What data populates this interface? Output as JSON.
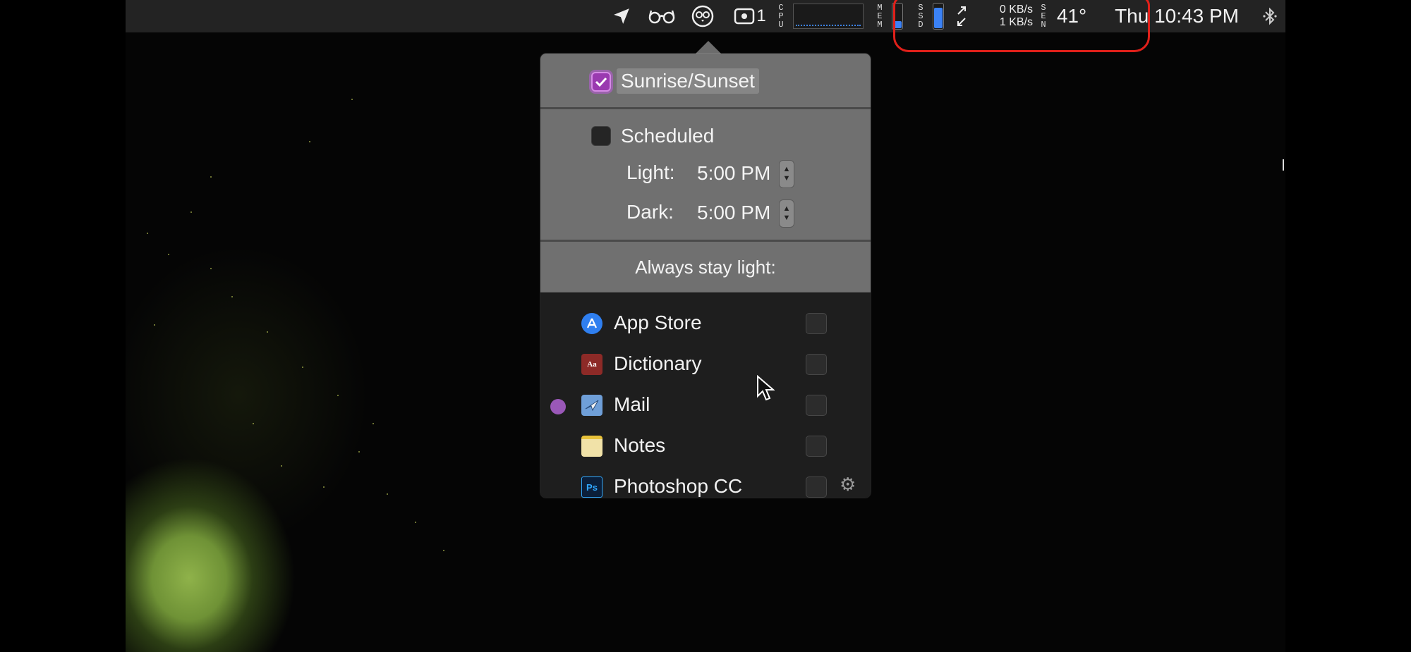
{
  "menubar": {
    "icons": [
      "location-arrow-icon",
      "glasses-icon",
      "night-owl-icon",
      "screen-record-icon"
    ],
    "record_suffix": "1",
    "cpu_label": [
      "C",
      "P",
      "U"
    ],
    "mem_label": [
      "M",
      "E",
      "M"
    ],
    "ssd_label": [
      "S",
      "S",
      "D"
    ],
    "sen_label": [
      "S",
      "E",
      "N"
    ],
    "net_up": "0 KB/s",
    "net_down": "1 KB/s",
    "temperature": "41°",
    "clock": "Thu 10:43 PM",
    "mem_fill": 0.3,
    "ssd_fill": 0.85,
    "accent": "#3b82f6"
  },
  "popover": {
    "sunrise_label": "Sunrise/Sunset",
    "sunrise_checked": true,
    "scheduled_label": "Scheduled",
    "scheduled_checked": false,
    "light_label": "Light:",
    "light_time": "5:00 PM",
    "dark_label": "Dark:",
    "dark_time": "5:00 PM",
    "always_light_label": "Always stay light:",
    "apps": [
      {
        "name": "App Store",
        "icon": "app-store-icon",
        "running": false,
        "checked": false
      },
      {
        "name": "Dictionary",
        "icon": "dictionary-icon",
        "running": false,
        "checked": false
      },
      {
        "name": "Mail",
        "icon": "mail-icon",
        "running": true,
        "checked": false
      },
      {
        "name": "Notes",
        "icon": "notes-icon",
        "running": false,
        "checked": false
      },
      {
        "name": "Photoshop CC",
        "icon": "photoshop-icon",
        "running": false,
        "checked": false
      }
    ]
  },
  "colors": {
    "checkbox_accent": "#9a3ab0",
    "running_dot": "#9a58b8",
    "annotation": "#e0201a"
  }
}
